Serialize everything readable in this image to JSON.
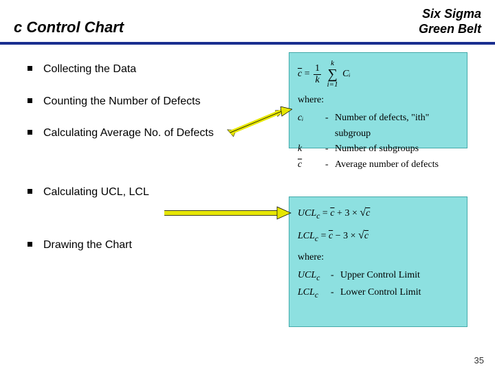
{
  "header": {
    "title": "c Control Chart",
    "badge_line1": "Six Sigma",
    "badge_line2": "Green Belt"
  },
  "bullets": {
    "b1": "Collecting the Data",
    "b2": "Counting the Number of Defects",
    "b3": "Calculating Average No. of Defects",
    "b4": "Calculating UCL, LCL",
    "b5": "Drawing the Chart"
  },
  "formula1": {
    "eq_lhs": "c",
    "eq_eq": "=",
    "frac_num": "1",
    "frac_den": "k",
    "sum_top": "k",
    "sum_bottom": "i=1",
    "sum_body": "Cᵢ",
    "where": "where:",
    "d1_sym": "cᵢ",
    "d1_txt": "Number of defects, \"ith\" subgroup",
    "d2_sym": "k",
    "d2_txt": "Number of subgroups",
    "d3_sym": "c",
    "d3_txt": "Average number of defects"
  },
  "formula2": {
    "ucl_lhs": "UCL",
    "ucl_sub": "c",
    "eq": " = ",
    "cbar": "c",
    "plus": " + 3 × ",
    "sqrt": "√",
    "lcl_lhs": "LCL",
    "minus": " − 3 × ",
    "where": "where:",
    "d1_sym": "UCL",
    "d1_txt": "Upper Control Limit",
    "d2_sym": "LCL",
    "d2_txt": "Lower Control Limit"
  },
  "page_number": "35"
}
